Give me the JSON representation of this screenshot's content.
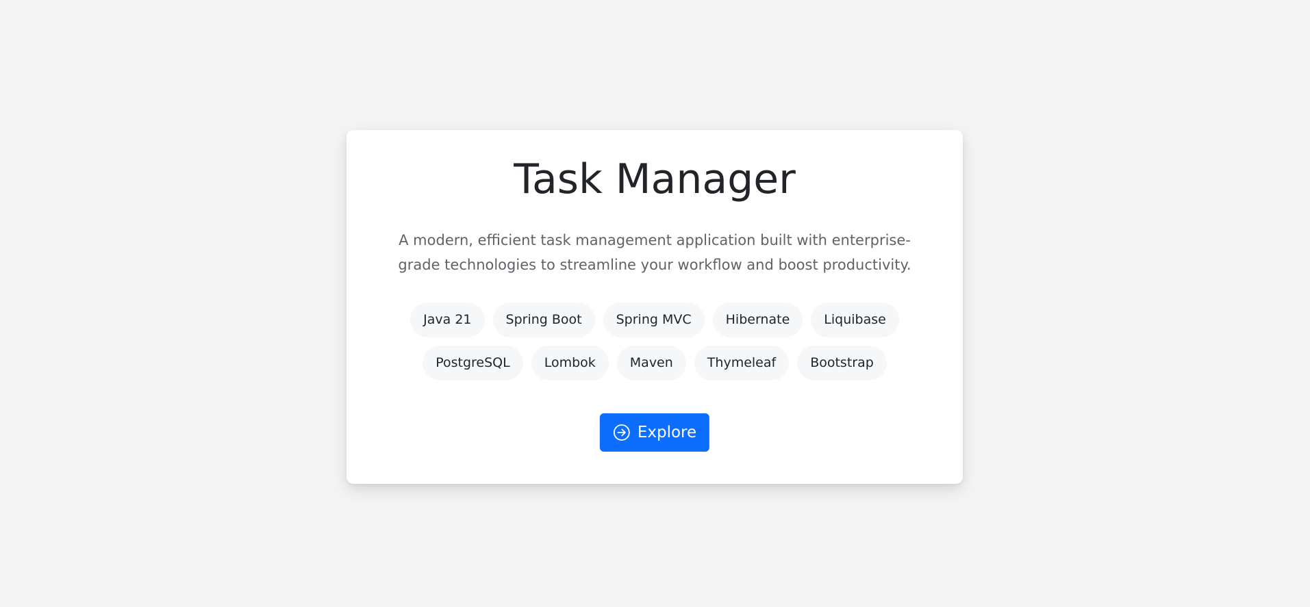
{
  "app": {
    "title": "Task Manager",
    "description": "A modern, efficient task management application built with enterprise-grade technologies to streamline your workflow and boost productivity."
  },
  "tags": [
    "Java 21",
    "Spring Boot",
    "Spring MVC",
    "Hibernate",
    "Liquibase",
    "PostgreSQL",
    "Lombok",
    "Maven",
    "Thymeleaf",
    "Bootstrap"
  ],
  "actions": {
    "explore_label": "Explore",
    "explore_icon": "arrow-right-circle-icon"
  },
  "colors": {
    "accent": "#0d6efd",
    "background": "#f4f4f4",
    "card": "#ffffff",
    "tag_background": "#f6f7f8"
  }
}
